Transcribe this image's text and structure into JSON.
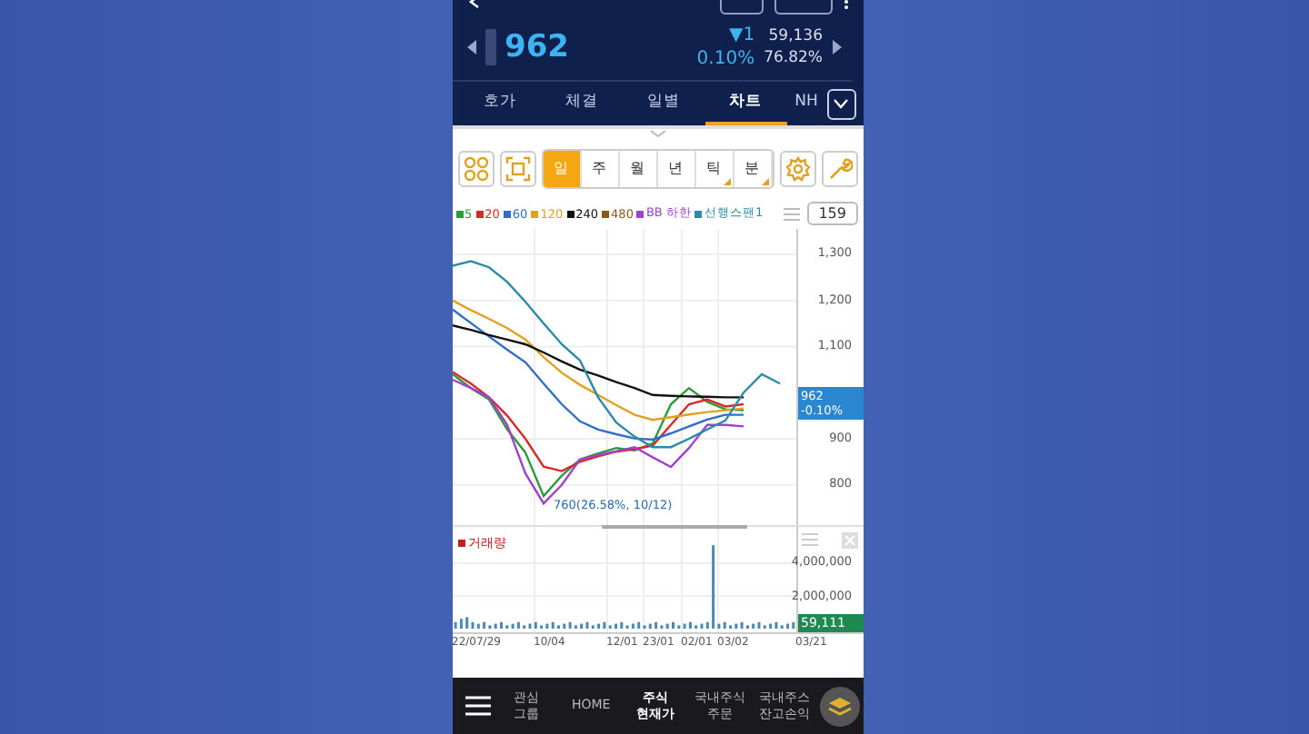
{
  "quote": {
    "price": "962",
    "change": "▼1",
    "change_rate": "0.10%",
    "volume": "59,136",
    "ratio": "76.82%"
  },
  "tabs": [
    {
      "label": "호가",
      "selected": false
    },
    {
      "label": "체결",
      "selected": false
    },
    {
      "label": "일별",
      "selected": false
    },
    {
      "label": "차트",
      "selected": true
    },
    {
      "label": "NH",
      "selected": false
    }
  ],
  "periods": [
    {
      "label": "일",
      "selected": true,
      "submenu": false
    },
    {
      "label": "주",
      "selected": false,
      "submenu": false
    },
    {
      "label": "월",
      "selected": false,
      "submenu": false
    },
    {
      "label": "년",
      "selected": false,
      "submenu": false
    },
    {
      "label": "틱",
      "selected": false,
      "submenu": true
    },
    {
      "label": "분",
      "selected": false,
      "submenu": true
    }
  ],
  "count": "159",
  "price_chart": {
    "chart_data": {
      "type": "line",
      "grid": true,
      "legend": true,
      "categories": [
        null,
        null,
        null,
        null,
        null,
        null,
        null,
        null,
        null,
        null,
        null,
        null,
        null,
        null,
        null,
        null,
        null,
        null,
        null
      ],
      "ylim": [
        713,
        1355
      ],
      "yticks": [
        {
          "value": 1300,
          "label": "1,300"
        },
        {
          "value": 1200,
          "label": "1,200"
        },
        {
          "value": 1100,
          "label": "1,100"
        },
        {
          "value": 900,
          "label": "900"
        },
        {
          "value": 800,
          "label": "800"
        }
      ],
      "series": [
        {
          "name": "5",
          "color": "#2e9b3a",
          "values": [
            1040,
            1010,
            985,
            920,
            870,
            776,
            820,
            855,
            868,
            880,
            875,
            890,
            975,
            1010,
            980,
            964,
            962,
            null,
            null
          ]
        },
        {
          "name": "20",
          "color": "#d62a2a",
          "values": [
            1045,
            1020,
            990,
            950,
            900,
            840,
            830,
            850,
            862,
            872,
            878,
            885,
            930,
            975,
            985,
            970,
            975,
            null,
            null
          ]
        },
        {
          "name": "60",
          "color": "#2f6fc7",
          "values": [
            1180,
            1151,
            1122,
            1093,
            1066,
            1020,
            975,
            938,
            920,
            910,
            901,
            898,
            912,
            927,
            942,
            952,
            952,
            null,
            null
          ]
        },
        {
          "name": "120",
          "color": "#e0a020",
          "values": [
            1200,
            1179,
            1160,
            1140,
            1115,
            1077,
            1043,
            1017,
            995,
            973,
            952,
            941,
            947,
            953,
            958,
            962,
            966,
            null,
            null
          ]
        },
        {
          "name": "240",
          "color": "#111111",
          "values": [
            1146,
            1136,
            1125,
            1115,
            1105,
            1087,
            1068,
            1050,
            1037,
            1023,
            1010,
            995,
            993,
            992,
            991,
            990,
            990,
            null,
            null
          ]
        },
        {
          "name": "480",
          "color": "#8a5a1a",
          "values": [
            null,
            null,
            null,
            null,
            null,
            null,
            null,
            null,
            null,
            null,
            null,
            null,
            null,
            null,
            null,
            null,
            null,
            null,
            null
          ]
        },
        {
          "name": "BB 하한",
          "color": "#a040d0",
          "values": [
            1028,
            1010,
            990,
            930,
            825,
            760,
            800,
            855,
            865,
            873,
            882,
            860,
            839,
            880,
            930,
            930,
            927,
            null,
            null
          ]
        },
        {
          "name": "선행스팬1",
          "color": "#2a8aa8",
          "values": [
            1275,
            1285,
            1272,
            1240,
            1197,
            1150,
            1105,
            1070,
            990,
            935,
            905,
            882,
            882,
            900,
            920,
            940,
            1000,
            1040,
            1020
          ]
        }
      ]
    }
  },
  "current_tag": {
    "price": "962",
    "rate": "-0.10%"
  },
  "low_annotation": "760(26.58%, 10/12)",
  "volume_chart": {
    "chart_data": {
      "type": "bar",
      "categories": [
        null,
        null,
        null,
        null,
        null,
        null,
        null,
        null,
        null,
        null,
        null,
        null,
        null,
        null,
        null,
        null,
        null,
        null,
        null,
        null,
        null,
        null,
        null,
        null,
        null,
        null,
        null,
        null,
        null,
        null,
        null,
        null,
        null,
        null,
        null,
        null,
        null,
        null,
        null,
        null,
        null,
        null,
        null,
        null,
        null,
        null,
        null,
        null,
        null,
        null,
        null,
        null,
        null,
        null,
        null,
        null,
        null,
        null,
        null,
        null
      ],
      "ylim": [
        0,
        6222222
      ],
      "yticks": [
        {
          "value": 4000000,
          "label": "4,000,000"
        },
        {
          "value": 2000000,
          "label": "2,000,000"
        }
      ],
      "series": [
        {
          "name": "거래량",
          "color": "#4a8ab0",
          "values": [
            400000,
            600000,
            700000,
            400000,
            300000,
            400000,
            200000,
            300000,
            400000,
            200000,
            300000,
            400000,
            200000,
            300000,
            400000,
            200000,
            300000,
            400000,
            200000,
            300000,
            400000,
            200000,
            300000,
            400000,
            200000,
            300000,
            400000,
            200000,
            300000,
            400000,
            200000,
            300000,
            400000,
            200000,
            300000,
            400000,
            200000,
            300000,
            400000,
            200000,
            300000,
            400000,
            200000,
            300000,
            400000,
            5100000,
            300000,
            400000,
            200000,
            300000,
            400000,
            200000,
            300000,
            400000,
            200000,
            300000,
            400000,
            200000,
            300000,
            400000
          ]
        }
      ]
    }
  },
  "volume_tag": "59,111",
  "dates": [
    "22/07/29",
    "10/04",
    "12/01",
    "23/01",
    "02/01",
    "03/02",
    "03/21"
  ],
  "nav": [
    {
      "lines": [
        "관심",
        "그룹"
      ],
      "selected": false
    },
    {
      "lines": [
        "HOME"
      ],
      "selected": false
    },
    {
      "lines": [
        "주식",
        "현재가"
      ],
      "selected": true
    },
    {
      "lines": [
        "국내주식",
        "주문"
      ],
      "selected": false
    },
    {
      "lines": [
        "국내주스",
        "잔고손익"
      ],
      "selected": false
    }
  ]
}
